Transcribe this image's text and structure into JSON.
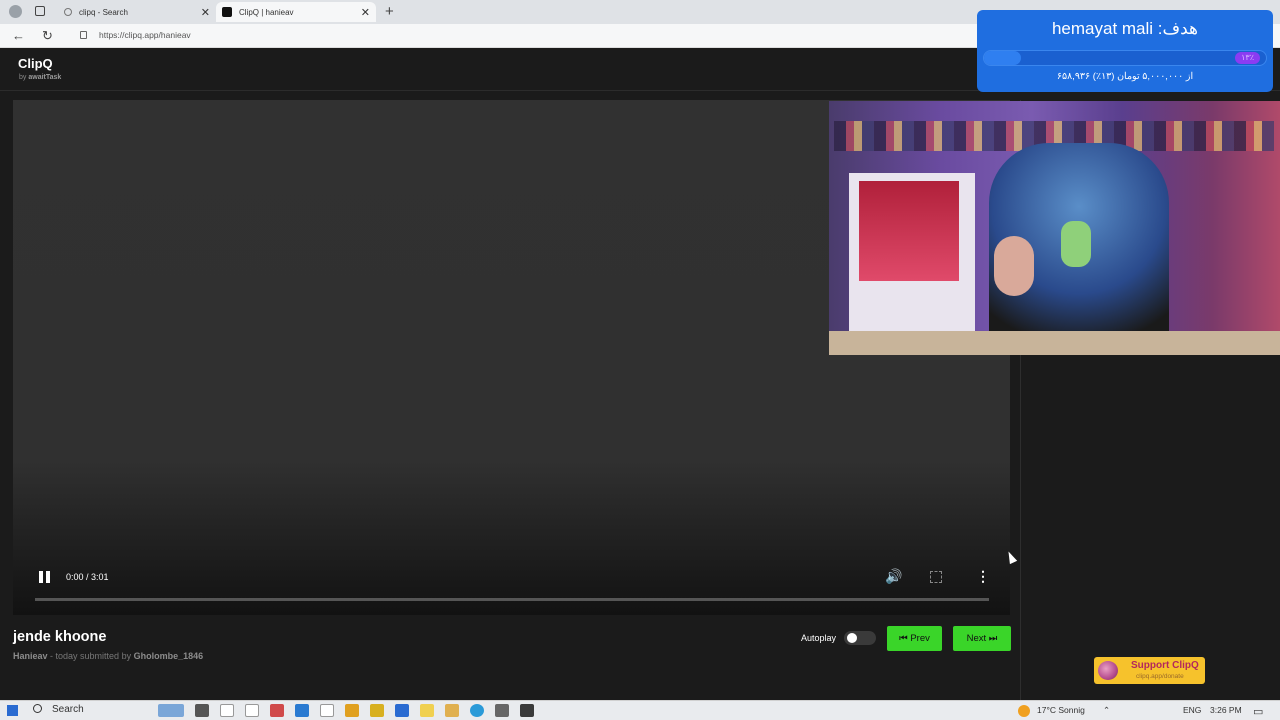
{
  "browser": {
    "tabs": [
      {
        "title": "clipq - Search"
      },
      {
        "title": "ClipQ | hanieav"
      }
    ],
    "url": "https://clipq.app/hanieav",
    "new_tab_symbol": "+"
  },
  "app": {
    "brand": "ClipQ",
    "brand_sub_prefix": "by",
    "brand_sub_author": "awaitTask"
  },
  "player": {
    "time": "0:00 / 3:01",
    "progress": 0
  },
  "clip": {
    "title": "jende khoone",
    "channel": "Hanieav",
    "submitted_text": " - today submitted by ",
    "submitter": "Gholombe_1846"
  },
  "controls": {
    "autoplay_label": "Autoplay",
    "autoplay_on": false,
    "prev_label": "⏮ Prev",
    "next_label": "Next ⏭"
  },
  "support": {
    "label": "Support ClipQ",
    "sub": "clipq.app/donate"
  },
  "donation_goal": {
    "title": "hemayat mali :هدف",
    "percent_badge": "۱۳٪",
    "percent": 13,
    "subtitle": "۶۵۸,۹۳۶ از ۵,۰۰۰,۰۰۰ تومان (۱۳٪)"
  },
  "taskbar": {
    "search_label": "Search",
    "weather": "17°C Sonnig",
    "lang": "ENG",
    "clock": "3:26 PM"
  },
  "colors": {
    "accent_green": "#3ad529",
    "goal_blue": "#1f6ee0",
    "support_yellow": "#f6c22c"
  }
}
